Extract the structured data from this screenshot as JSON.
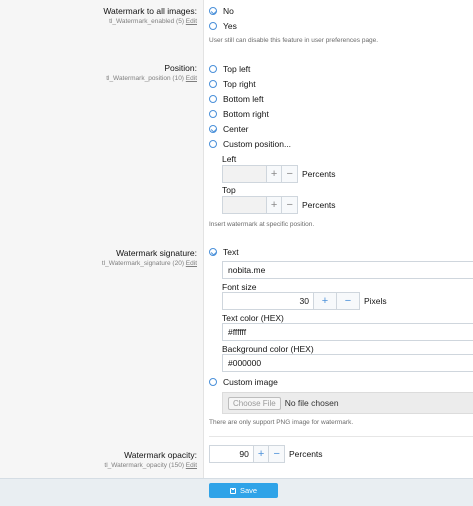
{
  "watermark_all": {
    "label": "Watermark to all images:",
    "hint": "tl_Watermark_enabled (5)",
    "edit": "Edit",
    "options": [
      {
        "label": "No",
        "checked": true
      },
      {
        "label": "Yes",
        "checked": false
      }
    ],
    "note": "User still can disable this feature in user preferences page."
  },
  "position": {
    "label": "Position:",
    "hint": "tl_Watermark_position (10)",
    "edit": "Edit",
    "options": [
      {
        "label": "Top left",
        "checked": false
      },
      {
        "label": "Top right",
        "checked": false
      },
      {
        "label": "Bottom left",
        "checked": false
      },
      {
        "label": "Bottom right",
        "checked": false
      },
      {
        "label": "Center",
        "checked": true
      },
      {
        "label": "Custom position...",
        "checked": false
      }
    ],
    "left_label": "Left",
    "left_value": "",
    "left_unit": "Percents",
    "top_label": "Top",
    "top_value": "",
    "top_unit": "Percents",
    "note": "Insert watermark at specific position."
  },
  "signature": {
    "label": "Watermark signature:",
    "hint": "tl_Watermark_signature (20)",
    "edit": "Edit",
    "text_option": {
      "label": "Text",
      "checked": true
    },
    "text_value": "nobita.me",
    "font_size_label": "Font size",
    "font_size_value": "30",
    "font_size_unit": "Pixels",
    "text_color_label": "Text color (HEX)",
    "text_color_value": "#ffffff",
    "bg_color_label": "Background color (HEX)",
    "bg_color_value": "#000000",
    "image_option": {
      "label": "Custom image",
      "checked": false
    },
    "choose_file": "Choose File",
    "no_file": "No file chosen",
    "note": "There are only support PNG image for watermark."
  },
  "opacity": {
    "label": "Watermark opacity:",
    "hint": "tl_Watermark_opacity (150)",
    "edit": "Edit",
    "value": "90",
    "unit": "Percents"
  },
  "buttons": {
    "plus": "+",
    "minus": "−",
    "save": "Save"
  },
  "colors": {
    "accent": "#4a90d9",
    "save_bg": "#2fa3e8"
  }
}
